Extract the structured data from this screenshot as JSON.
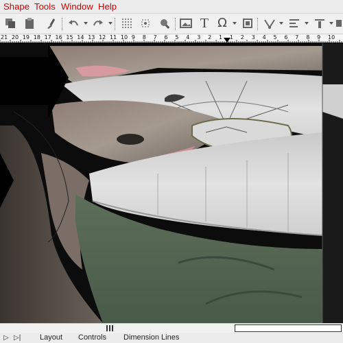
{
  "menu": [
    {
      "label": "Shape"
    },
    {
      "label": "Tools"
    },
    {
      "label": "Window"
    },
    {
      "label": "Help"
    }
  ],
  "toolbar": {
    "icons": [
      "copy-icon",
      "paste-icon",
      "format-painter-icon",
      "grid-icon",
      "snap-icon",
      "zoom-region-icon",
      "image-icon",
      "text-icon",
      "symbol-icon",
      "resize-icon",
      "curve-icon",
      "align-icon",
      "text-align-icon",
      "stack-icon"
    ],
    "text_tool": "T",
    "symbol_tool": "Ω"
  },
  "ruler": {
    "numbers": [
      "21",
      "20",
      "19",
      "18",
      "17",
      "16",
      "15",
      "14",
      "13",
      "12",
      "11",
      "10",
      "9",
      "8",
      "7",
      "6",
      "5",
      "4",
      "3",
      "2",
      "1",
      "1",
      "2",
      "3",
      "4",
      "5",
      "6",
      "7",
      "8",
      "9",
      "10"
    ]
  },
  "tabs": {
    "nav_prev": "▷",
    "nav_last": "▷|",
    "items": [
      {
        "label": "Layout"
      },
      {
        "label": "Controls"
      },
      {
        "label": "Dimension Lines"
      }
    ]
  },
  "colors": {
    "menu_text": "#cc0000",
    "canvas_bg": "#111111"
  }
}
